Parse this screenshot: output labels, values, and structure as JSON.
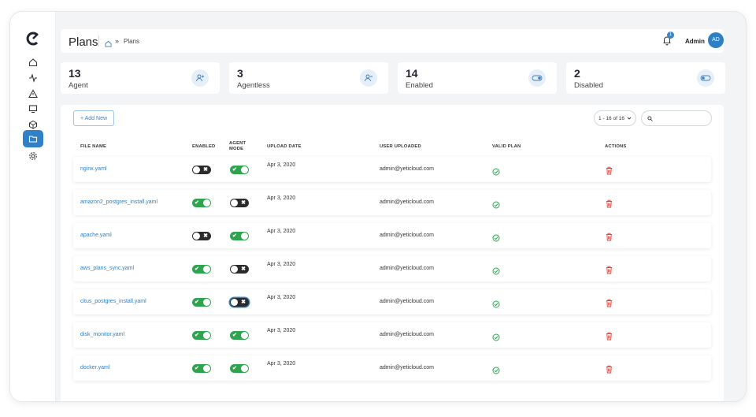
{
  "header": {
    "title": "Plans",
    "breadcrumb_current": "Plans",
    "breadcrumb_separator": "»",
    "notification_count": "1",
    "user_name": "Admin",
    "user_initials": "AD"
  },
  "sidebar": {
    "items": [
      "home",
      "activity",
      "alerts",
      "monitor",
      "packages",
      "plans",
      "settings"
    ],
    "active": "plans"
  },
  "stats": [
    {
      "value": "13",
      "label": "Agent",
      "icon": "user-plus-icon"
    },
    {
      "value": "3",
      "label": "Agentless",
      "icon": "user-minus-icon"
    },
    {
      "value": "14",
      "label": "Enabled",
      "icon": "toggle-on-icon"
    },
    {
      "value": "2",
      "label": "Disabled",
      "icon": "toggle-off-icon"
    }
  ],
  "toolbar": {
    "add_label": "+ Add New",
    "pager_label": "1 - 16 of 16",
    "search_placeholder": ""
  },
  "table": {
    "headers": {
      "file_name": "FILE NAME",
      "enabled": "ENABLED",
      "agent_mode_1": "AGENT",
      "agent_mode_2": "MODE",
      "upload_date": "UPLOAD DATE",
      "user_uploaded": "USER UPLOADED",
      "valid_plan": "VALID PLAN",
      "actions": "ACTIONS"
    },
    "rows": [
      {
        "file": "nginx.yaml",
        "enabled": false,
        "agent_mode": true,
        "date": "Apr 3, 2020",
        "user": "admin@yeticloud.com",
        "valid": true
      },
      {
        "file": "amazon2_postgres_install.yaml",
        "enabled": true,
        "agent_mode": false,
        "date": "Apr 3, 2020",
        "user": "admin@yeticloud.com",
        "valid": true
      },
      {
        "file": "apache.yaml",
        "enabled": false,
        "agent_mode": true,
        "date": "Apr 3, 2020",
        "user": "admin@yeticloud.com",
        "valid": true
      },
      {
        "file": "aws_plans_sync.yaml",
        "enabled": true,
        "agent_mode": false,
        "date": "Apr 3, 2020",
        "user": "admin@yeticloud.com",
        "valid": true
      },
      {
        "file": "citus_postgres_install.yaml",
        "enabled": true,
        "agent_mode": false,
        "date": "Apr 3, 2020",
        "user": "admin@yeticloud.com",
        "valid": true
      },
      {
        "file": "disk_monitor.yaml",
        "enabled": true,
        "agent_mode": true,
        "date": "Apr 3, 2020",
        "user": "admin@yeticloud.com",
        "valid": true
      },
      {
        "file": "docker.yaml",
        "enabled": true,
        "agent_mode": true,
        "date": "Apr 3, 2020",
        "user": "admin@yeticloud.com",
        "valid": true
      }
    ]
  },
  "colors": {
    "accent": "#2f80c6",
    "toggle_on": "#2ea44f",
    "toggle_off": "#2b2b2b",
    "valid": "#2ea44f",
    "delete": "#e0413a"
  }
}
